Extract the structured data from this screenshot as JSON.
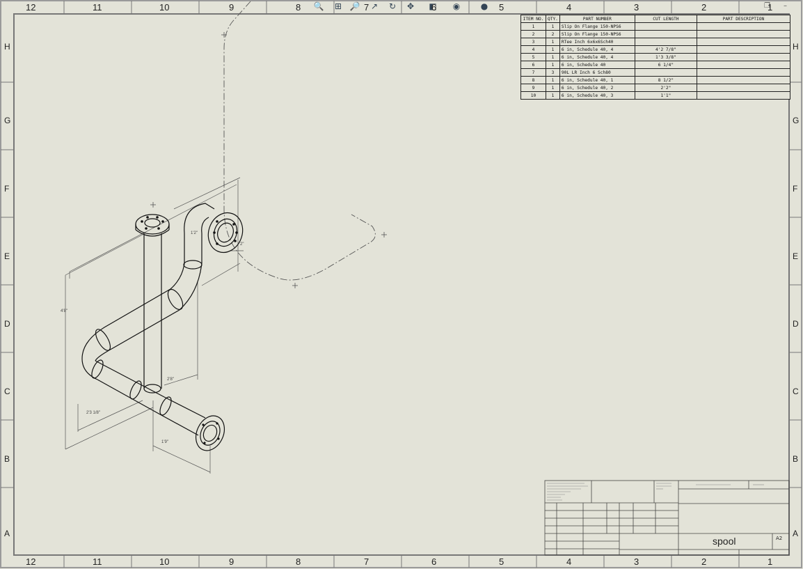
{
  "toolbar": {
    "icons": [
      "zoom-to-fit-icon",
      "zoom-area-icon",
      "zoom-in-out-icon",
      "select-icon",
      "rotate-icon",
      "pan-icon",
      "display-style-icon",
      "view-orientation-icon",
      "appearance-icon"
    ]
  },
  "border": {
    "columns": [
      "12",
      "11",
      "10",
      "9",
      "8",
      "7",
      "6",
      "5",
      "4",
      "3",
      "2",
      "1"
    ],
    "rows": [
      "H",
      "G",
      "F",
      "E",
      "D",
      "C",
      "B",
      "A"
    ]
  },
  "bom": {
    "headers": [
      "ITEM NO.",
      "QTY.",
      "PART NUMBER",
      "CUT LENGTH",
      "PART DESCRIPTION"
    ],
    "rows": [
      {
        "item": "1",
        "qty": "1",
        "part": "Slip On Flange 150-NPS6",
        "cut": "",
        "desc": ""
      },
      {
        "item": "2",
        "qty": "2",
        "part": "Slip On Flange 150-NPS6",
        "cut": "",
        "desc": ""
      },
      {
        "item": "3",
        "qty": "1",
        "part": "RTee Inch 6x6x6Sch40",
        "cut": "",
        "desc": ""
      },
      {
        "item": "4",
        "qty": "1",
        "part": "6 in, Schedule 40, 4",
        "cut": "4'2 7/8\"",
        "desc": ""
      },
      {
        "item": "5",
        "qty": "1",
        "part": "6 in, Schedule 40, 4",
        "cut": "1'3 3/8\"",
        "desc": ""
      },
      {
        "item": "6",
        "qty": "1",
        "part": "6 in, Schedule 40",
        "cut": "6 1/4\"",
        "desc": ""
      },
      {
        "item": "7",
        "qty": "3",
        "part": "90L LR Inch 6 Sch80",
        "cut": "",
        "desc": ""
      },
      {
        "item": "8",
        "qty": "1",
        "part": "6 in, Schedule 40, 1",
        "cut": "8 1/2\"",
        "desc": ""
      },
      {
        "item": "9",
        "qty": "1",
        "part": "6 in, Schedule 40, 2",
        "cut": "2'2\"",
        "desc": ""
      },
      {
        "item": "10",
        "qty": "1",
        "part": "6 in, Schedule 40, 3",
        "cut": "1'1\"",
        "desc": ""
      }
    ]
  },
  "title_block": {
    "title": "spool",
    "size": "A2"
  },
  "dimensions": {
    "d1": "4'8\"",
    "d2": "2'8\"",
    "d3": "2'3 1/8\"",
    "d4": "1'9\"",
    "d5": "1'2\"",
    "d6": "2\""
  }
}
